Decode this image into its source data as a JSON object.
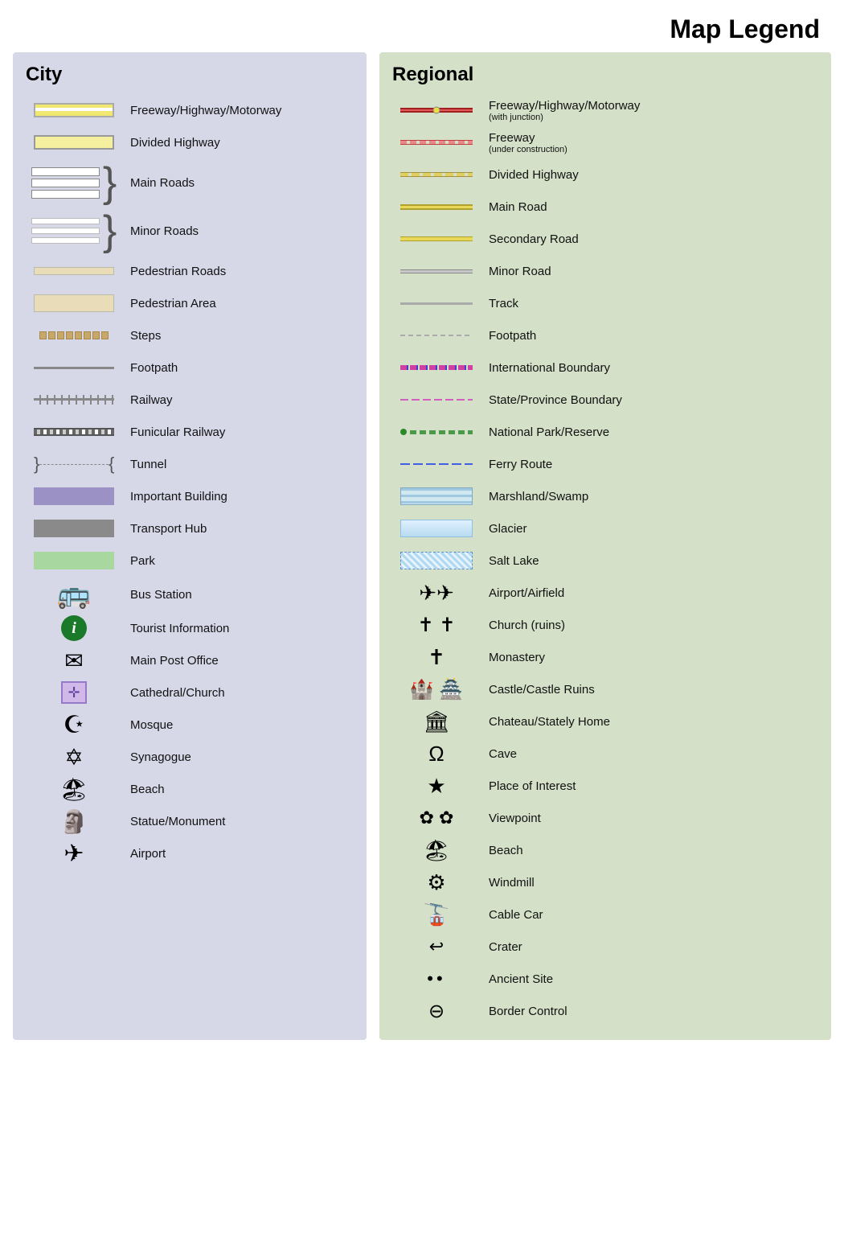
{
  "page": {
    "title": "Map Legend"
  },
  "city": {
    "panel_title": "City",
    "items": [
      {
        "id": "freeway",
        "label": "Freeway/Highway/Motorway",
        "symbol_type": "road-freeway"
      },
      {
        "id": "divided-hwy",
        "label": "Divided Highway",
        "symbol_type": "road-divided"
      },
      {
        "id": "main-roads",
        "label": "Main Roads",
        "symbol_type": "brace-main"
      },
      {
        "id": "minor-roads",
        "label": "Minor Roads",
        "symbol_type": "brace-minor"
      },
      {
        "id": "pedestrian-roads",
        "label": "Pedestrian Roads",
        "symbol_type": "road-pedestrian"
      },
      {
        "id": "pedestrian-area",
        "label": "Pedestrian Area",
        "symbol_type": "road-ped-area"
      },
      {
        "id": "steps",
        "label": "Steps",
        "symbol_type": "steps"
      },
      {
        "id": "footpath",
        "label": "Footpath",
        "symbol_type": "footpath"
      },
      {
        "id": "railway",
        "label": "Railway",
        "symbol_type": "railway"
      },
      {
        "id": "funicular",
        "label": "Funicular Railway",
        "symbol_type": "funicular"
      },
      {
        "id": "tunnel",
        "label": "Tunnel",
        "symbol_type": "tunnel"
      },
      {
        "id": "important-building",
        "label": "Important Building",
        "symbol_type": "important-building"
      },
      {
        "id": "transport-hub",
        "label": "Transport Hub",
        "symbol_type": "transport-hub"
      },
      {
        "id": "park",
        "label": "Park",
        "symbol_type": "park"
      },
      {
        "id": "bus-station",
        "label": "Bus Station",
        "symbol_type": "bus"
      },
      {
        "id": "tourist-info",
        "label": "Tourist Information",
        "symbol_type": "info"
      },
      {
        "id": "post-office",
        "label": "Main Post Office",
        "symbol_type": "post"
      },
      {
        "id": "cathedral",
        "label": "Cathedral/Church",
        "symbol_type": "church-box"
      },
      {
        "id": "mosque",
        "label": "Mosque",
        "symbol_type": "mosque"
      },
      {
        "id": "synagogue",
        "label": "Synagogue",
        "symbol_type": "synagogue"
      },
      {
        "id": "beach-city",
        "label": "Beach",
        "symbol_type": "beach"
      },
      {
        "id": "statue",
        "label": "Statue/Monument",
        "symbol_type": "statue"
      },
      {
        "id": "airport-city",
        "label": "Airport",
        "symbol_type": "airport-city"
      }
    ]
  },
  "regional": {
    "panel_title": "Regional",
    "items": [
      {
        "id": "r-freeway-j",
        "label": "Freeway/Highway/Motorway",
        "sublabel": "(with junction)",
        "symbol_type": "r-freeway-junction"
      },
      {
        "id": "r-freeway-uc",
        "label": "Freeway",
        "sublabel": "(under construction)",
        "symbol_type": "r-freeway-uc"
      },
      {
        "id": "r-divided",
        "label": "Divided Highway",
        "symbol_type": "r-divided"
      },
      {
        "id": "r-main",
        "label": "Main Road",
        "symbol_type": "r-main"
      },
      {
        "id": "r-secondary",
        "label": "Secondary Road",
        "symbol_type": "r-secondary"
      },
      {
        "id": "r-minor",
        "label": "Minor Road",
        "symbol_type": "r-minor"
      },
      {
        "id": "r-track",
        "label": "Track",
        "symbol_type": "r-track"
      },
      {
        "id": "r-footpath",
        "label": "Footpath",
        "symbol_type": "r-footpath"
      },
      {
        "id": "r-intl-boundary",
        "label": "International Boundary",
        "symbol_type": "r-intl-boundary"
      },
      {
        "id": "r-state-boundary",
        "label": "State/Province Boundary",
        "symbol_type": "r-state-boundary"
      },
      {
        "id": "r-nat-park",
        "label": "National Park/Reserve",
        "symbol_type": "r-nat-park"
      },
      {
        "id": "r-ferry-route",
        "label": "Ferry Route",
        "symbol_type": "r-ferry"
      },
      {
        "id": "r-marsh",
        "label": "Marshland/Swamp",
        "symbol_type": "r-marsh"
      },
      {
        "id": "r-glacier",
        "label": "Glacier",
        "symbol_type": "r-glacier"
      },
      {
        "id": "r-salt-lake",
        "label": "Salt Lake",
        "symbol_type": "r-salt-lake"
      },
      {
        "id": "r-airport",
        "label": "Airport/Airfield",
        "symbol_type": "r-airport"
      },
      {
        "id": "r-church",
        "label": "Church (ruins)",
        "symbol_type": "r-church"
      },
      {
        "id": "r-monastery",
        "label": "Monastery",
        "symbol_type": "r-monastery"
      },
      {
        "id": "r-castle",
        "label": "Castle/Castle Ruins",
        "symbol_type": "r-castle"
      },
      {
        "id": "r-chateau",
        "label": "Chateau/Stately Home",
        "symbol_type": "r-chateau"
      },
      {
        "id": "r-cave",
        "label": "Cave",
        "symbol_type": "r-cave"
      },
      {
        "id": "r-place",
        "label": "Place of Interest",
        "symbol_type": "r-place"
      },
      {
        "id": "r-viewpoint",
        "label": "Viewpoint",
        "symbol_type": "r-viewpoint"
      },
      {
        "id": "r-beach",
        "label": "Beach",
        "symbol_type": "r-beach"
      },
      {
        "id": "r-windmill",
        "label": "Windmill",
        "symbol_type": "r-windmill"
      },
      {
        "id": "r-cable-car",
        "label": "Cable Car",
        "symbol_type": "r-cable-car"
      },
      {
        "id": "r-crater",
        "label": "Crater",
        "symbol_type": "r-crater"
      },
      {
        "id": "r-ancient",
        "label": "Ancient Site",
        "symbol_type": "r-ancient"
      },
      {
        "id": "r-border",
        "label": "Border Control",
        "symbol_type": "r-border"
      }
    ]
  }
}
